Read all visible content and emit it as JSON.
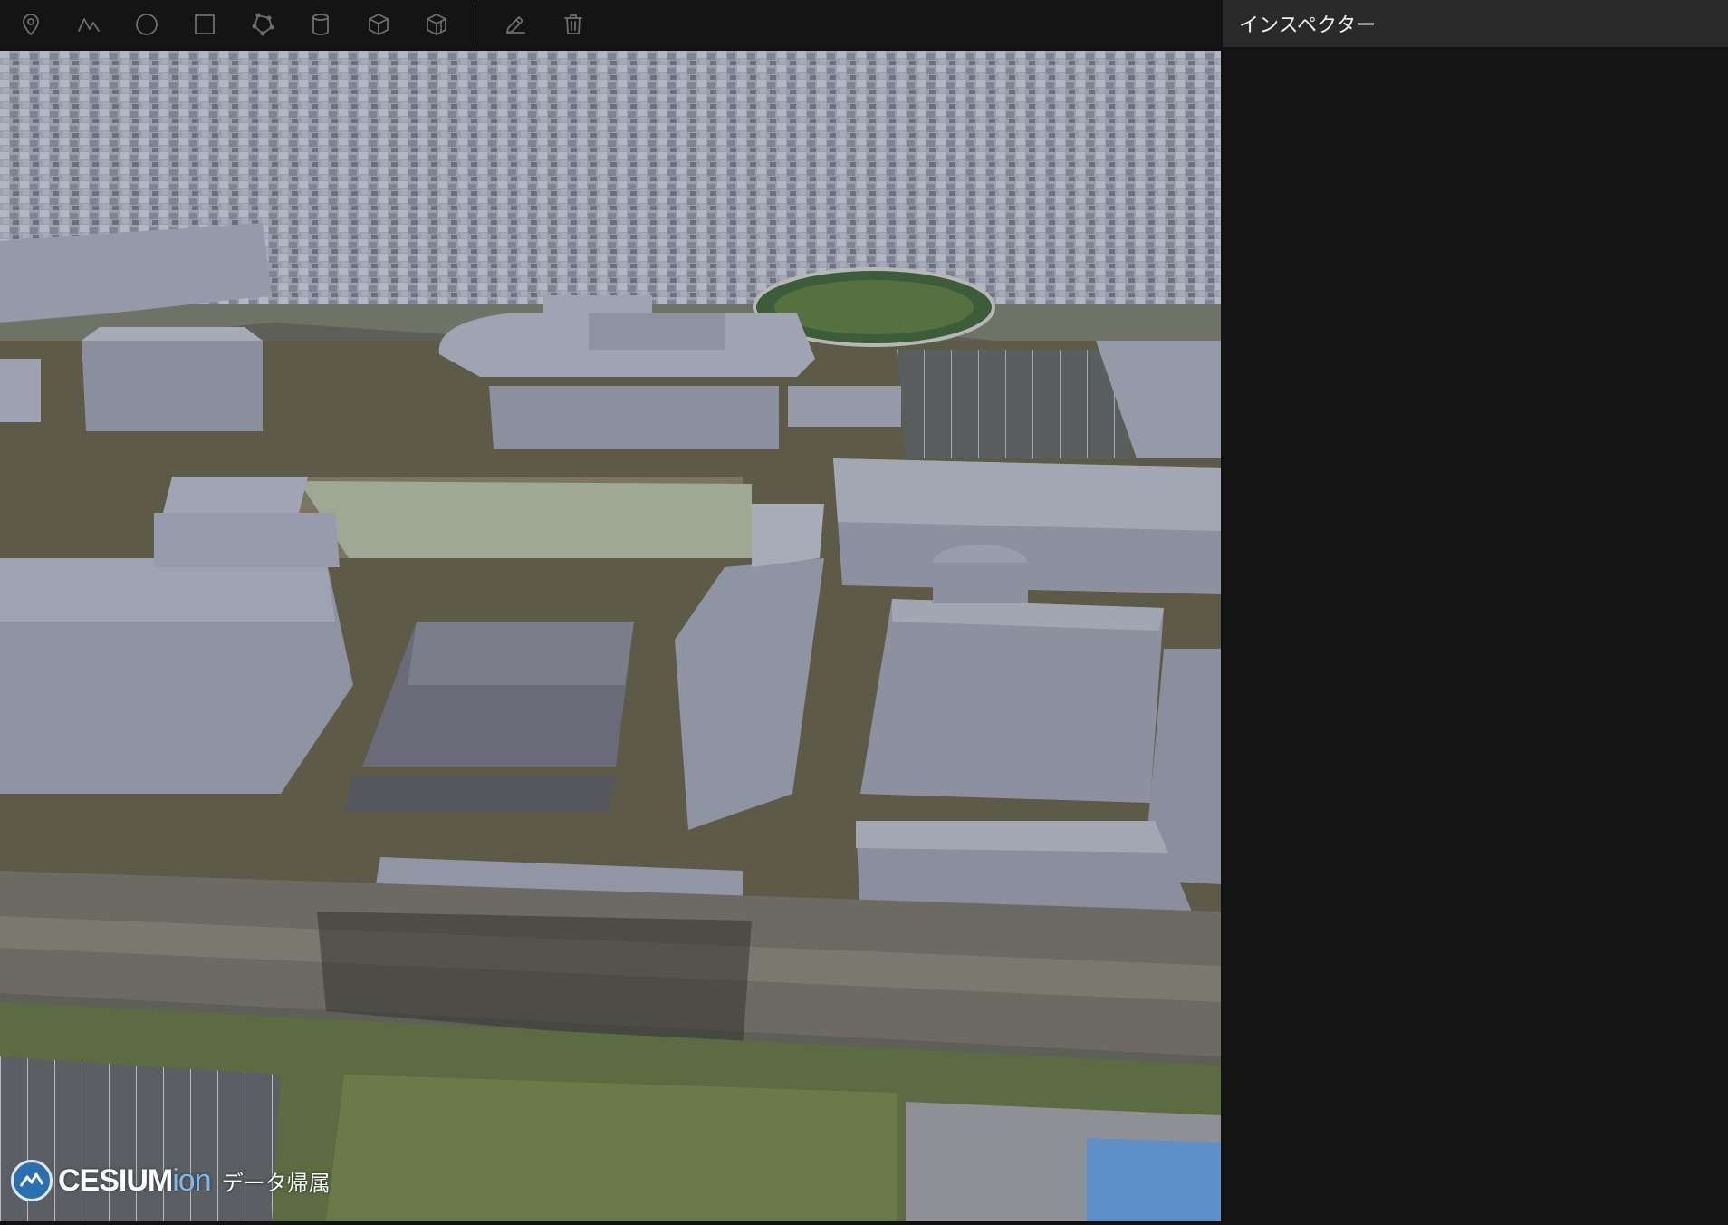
{
  "toolbar": {
    "tools": [
      {
        "name": "map-pin-icon"
      },
      {
        "name": "polyline-icon"
      },
      {
        "name": "circle-icon"
      },
      {
        "name": "rectangle-icon"
      },
      {
        "name": "polygon-icon"
      },
      {
        "name": "cylinder-icon"
      },
      {
        "name": "box-icon"
      },
      {
        "name": "extrude-icon"
      },
      {
        "name": "edit-icon"
      },
      {
        "name": "trash-icon"
      }
    ]
  },
  "inspector": {
    "title": "インスペクター"
  },
  "viewer": {
    "credit_brand": "CESIUM",
    "credit_brand_suffix": "ion",
    "credit_attribution": "データ帰属"
  },
  "colors": {
    "toolbar_bg": "#141414",
    "inspector_header_bg": "#2a2a2a",
    "building": "#8b909f",
    "icon": "#6e6e6e"
  }
}
